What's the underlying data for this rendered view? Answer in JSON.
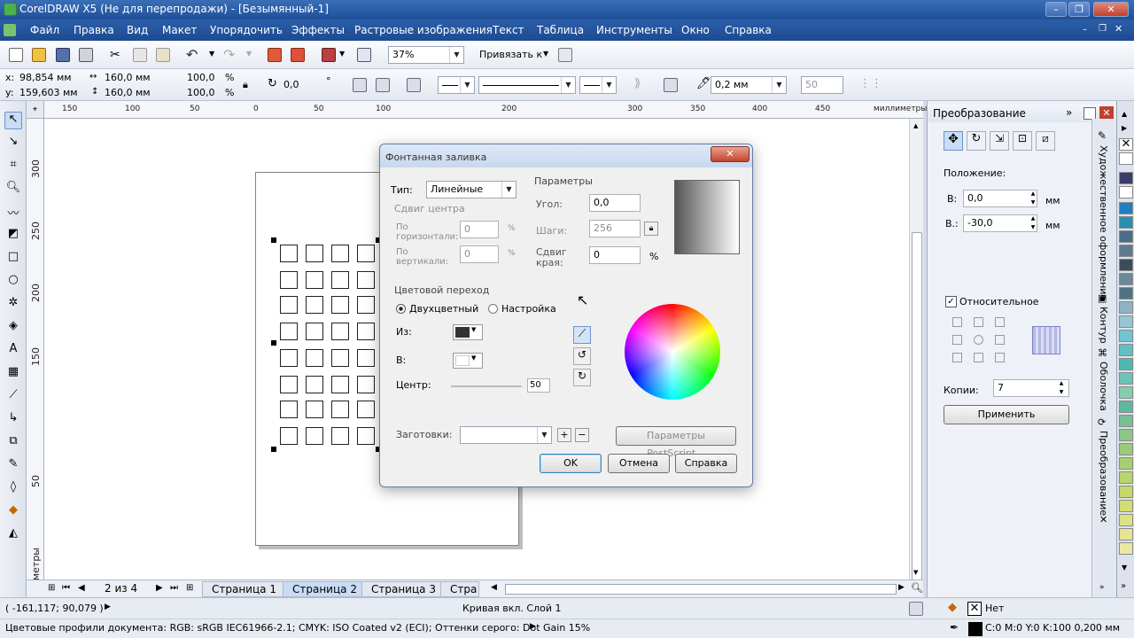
{
  "window": {
    "title": "CorelDRAW X5 (Не для перепродажи) - [Безымянный-1]"
  },
  "menu": [
    "Файл",
    "Правка",
    "Вид",
    "Макет",
    "Упорядочить",
    "Эффекты",
    "Растровые изображения",
    "Текст",
    "Таблица",
    "Инструменты",
    "Окно",
    "Справка"
  ],
  "toolbar": {
    "zoom": "37%",
    "snap_label": "Привязать к"
  },
  "property_bar": {
    "x_label": "x:",
    "x_value": "98,854 мм",
    "y_label": "y:",
    "y_value": "159,603 мм",
    "width": "160,0 мм",
    "height": "160,0 мм",
    "scale_x": "100,0",
    "scale_y": "100,0",
    "percent": "%",
    "rotation": "0,0",
    "degree": "°",
    "outline_width": "0,2 мм",
    "spin_value": "50"
  },
  "ruler": {
    "h_ticks": [
      "150",
      "100",
      "50",
      "0",
      "50",
      "100",
      "150",
      "200",
      "250",
      "300",
      "350",
      "400",
      "450"
    ],
    "h_unit": "миллиметры",
    "v_ticks": [
      "300",
      "250",
      "200",
      "150",
      "100",
      "50"
    ],
    "v_unit": "миллиметры"
  },
  "pages": {
    "counter": "2 из 4",
    "tabs": [
      "Страница 1",
      "Страница 2",
      "Страница 3",
      "Стра"
    ],
    "active": 1
  },
  "status": {
    "coords": "( -161,117; 90,079 )",
    "object_info": "Кривая вкл. Слой 1",
    "fill": "Нет",
    "color_profiles": "Цветовые профили документа: RGB: sRGB IEC61966-2.1; CMYK: ISO Coated v2 (ECI); Оттенки серого: Dot Gain 15%",
    "outline": "C:0 M:0 Y:0 K:100  0,200 мм"
  },
  "docker": {
    "title": "Преобразование",
    "position_label": "Положение:",
    "h_label": "В:",
    "h_value": "0,0",
    "v_label": "В.:",
    "v_value": "-30,0",
    "unit": "мм",
    "relative_label": "Относительное",
    "copies_label": "Копии:",
    "copies_value": "7",
    "apply_label": "Применить",
    "side_tabs": [
      "Художественное оформление",
      "Контур",
      "Оболочка",
      "Преобразование"
    ]
  },
  "dialog": {
    "title": "Фонтанная заливка",
    "type_label": "Тип:",
    "type_value": "Линейные",
    "center_offset": "Сдвиг центра",
    "horizontal": "По горизонтали:",
    "horizontal_value": "0",
    "vertical": "По вертикали:",
    "vertical_value": "0",
    "options": "Параметры",
    "angle_label": "Угол:",
    "angle_value": "0,0",
    "steps_label": "Шаги:",
    "steps_value": "256",
    "edge_label": "Сдвиг края:",
    "edge_value": "0",
    "percent": "%",
    "color_blend": "Цветовой переход",
    "two_color": "Двухцветный",
    "custom": "Настройка",
    "from_label": "Из:",
    "to_label": "В:",
    "mid_label": "Центр:",
    "mid_value": "50",
    "presets_label": "Заготовки:",
    "postscript_label": "Параметры PostScript...",
    "ok": "OK",
    "cancel": "Отмена",
    "help": "Справка"
  },
  "colors": {
    "title_bar": "#1f4f9a",
    "selection_handle": "#000000",
    "docker_button": "#e7ebf3"
  }
}
